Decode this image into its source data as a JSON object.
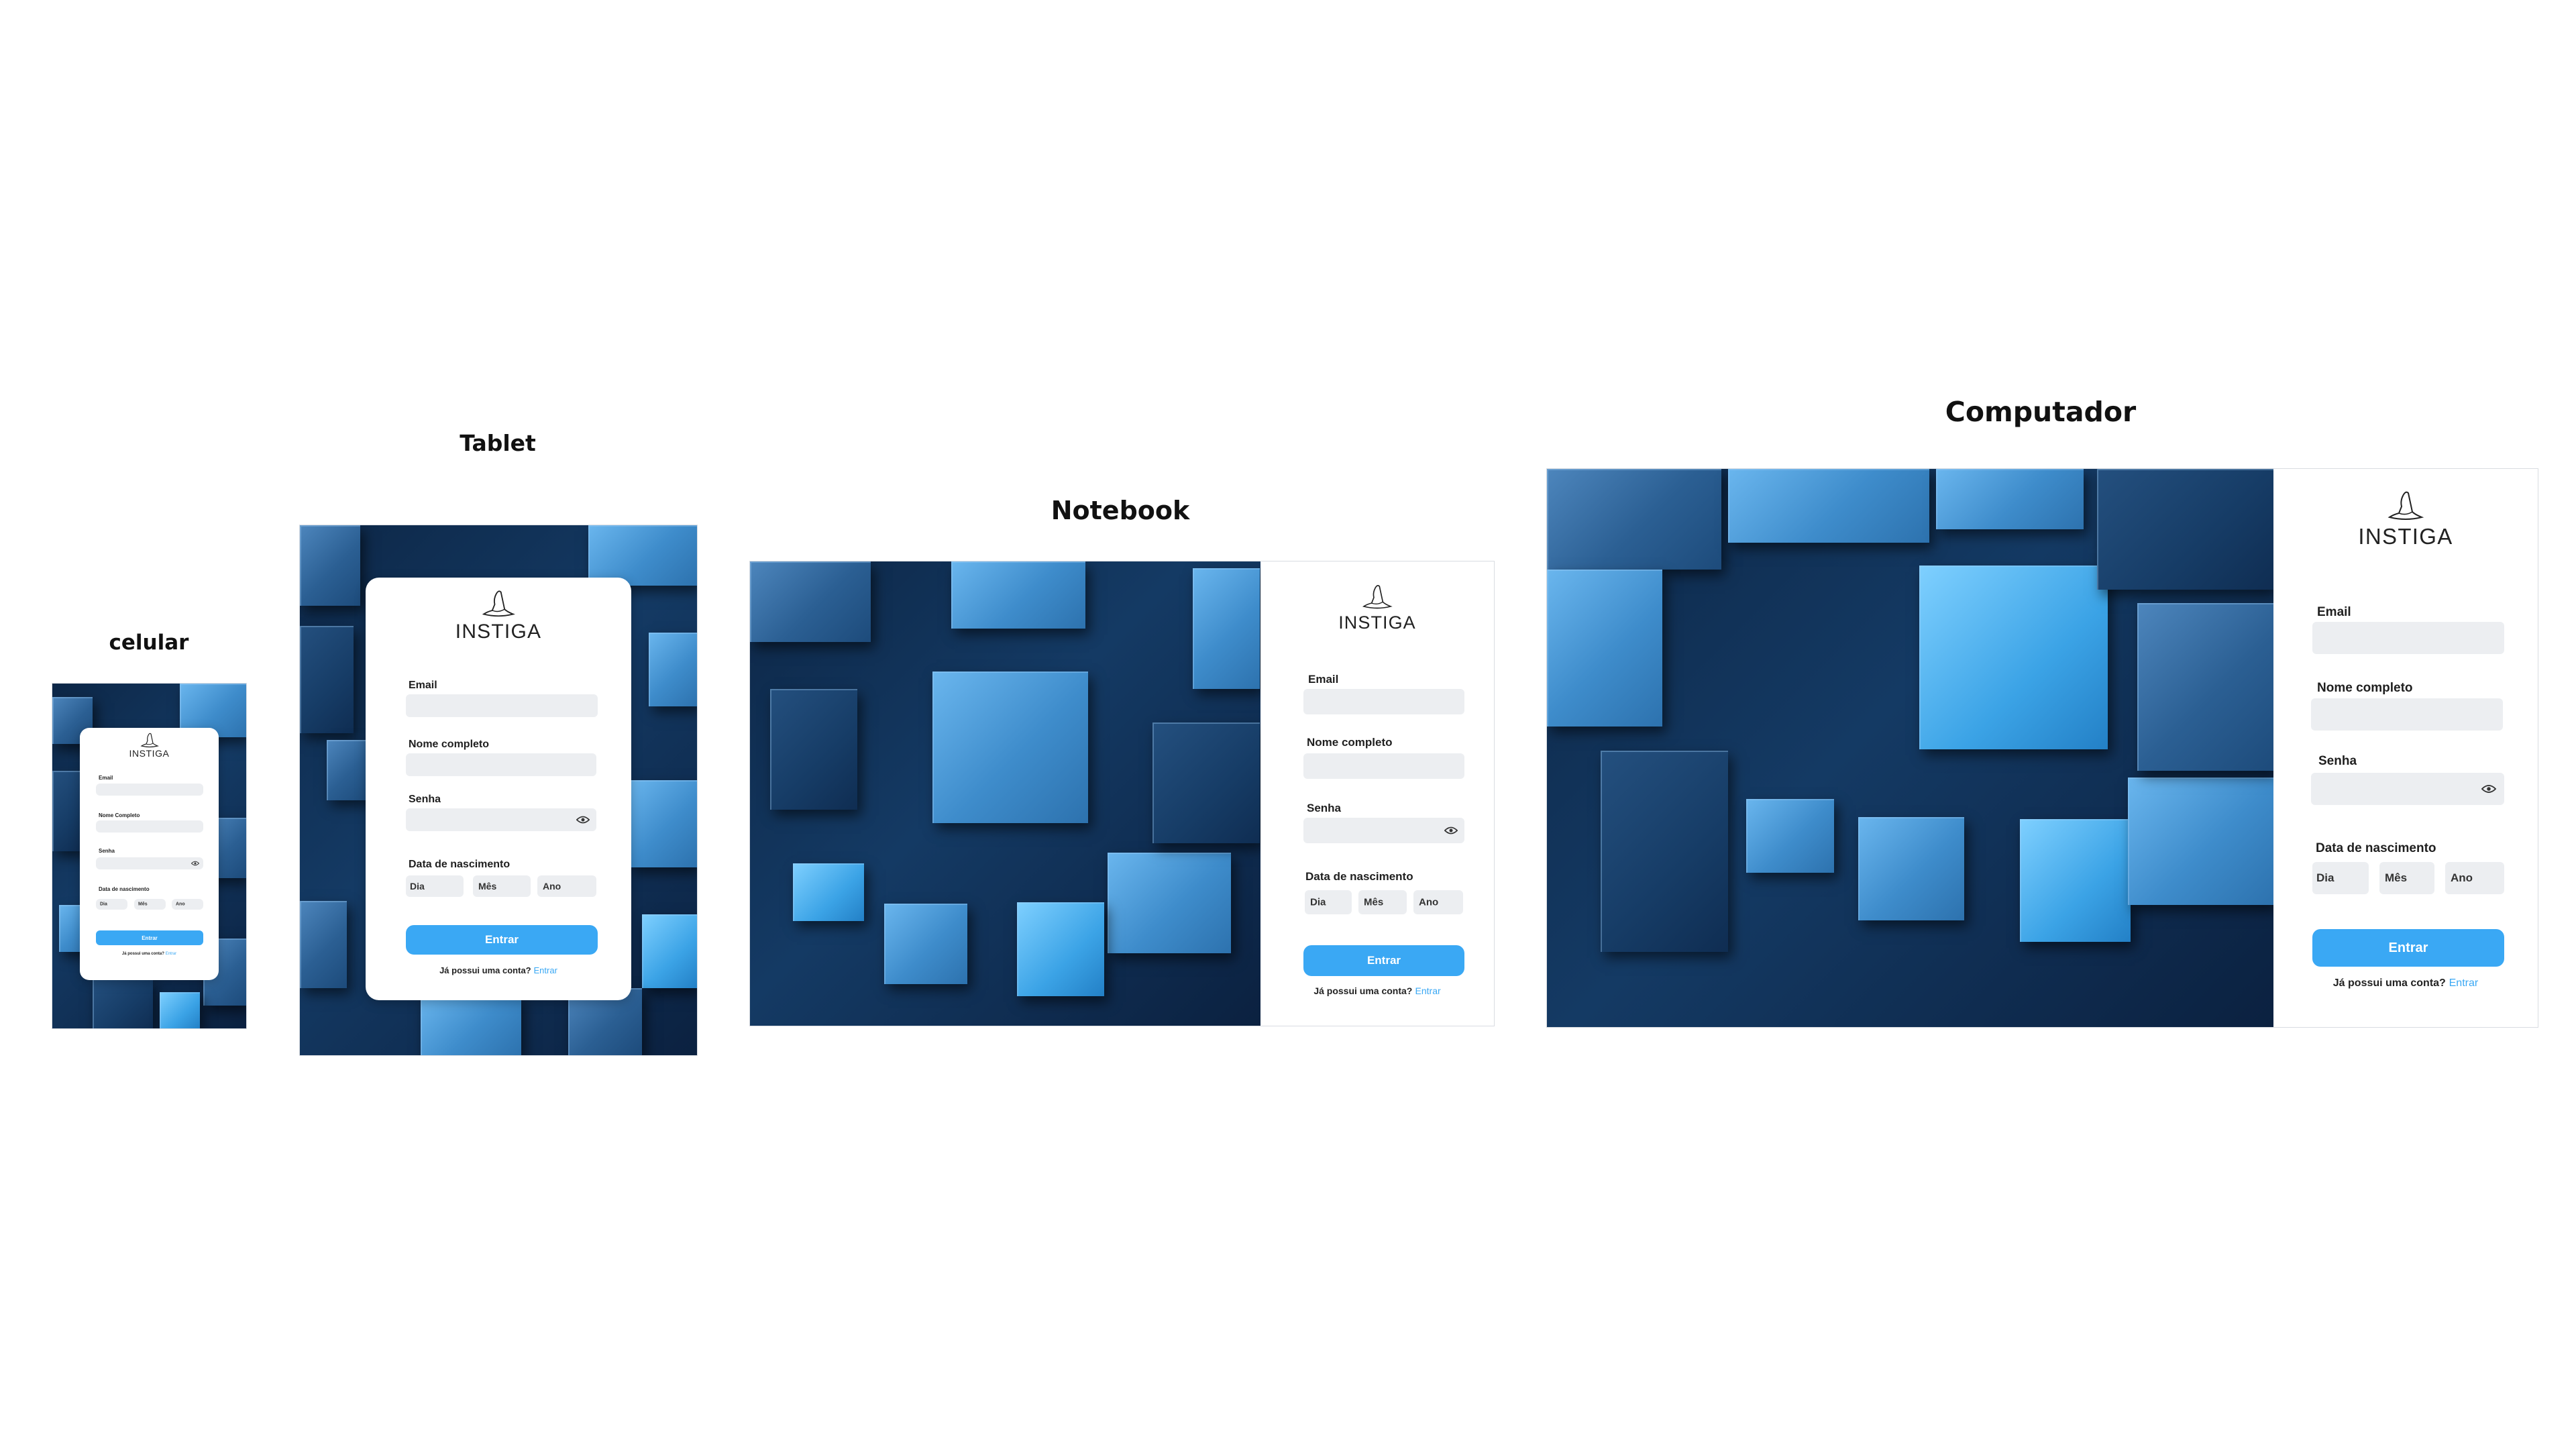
{
  "titles": {
    "phone": "celular",
    "tablet": "Tablet",
    "notebook": "Notebook",
    "desktop": "Computador"
  },
  "form": {
    "brand": "INSTIGA",
    "email_label": "Email",
    "name_label": "Nome completo",
    "name_label_phone": "Nome Completo",
    "password_label": "Senha",
    "birthdate_label": "Data de nascimento",
    "day": "Dia",
    "month": "Mês",
    "year": "Ano",
    "submit_label": "Entrar",
    "footer_text": "Já possui uma conta?",
    "footer_link": "Entrar"
  },
  "icons": {
    "logo": "wizard-hat-icon",
    "password_toggle": "eye-icon"
  },
  "colors": {
    "accent": "#3aa8f4",
    "input_bg": "#eceef1",
    "background_dark": "#0d2747",
    "cube_blue": "#2b5f93"
  }
}
